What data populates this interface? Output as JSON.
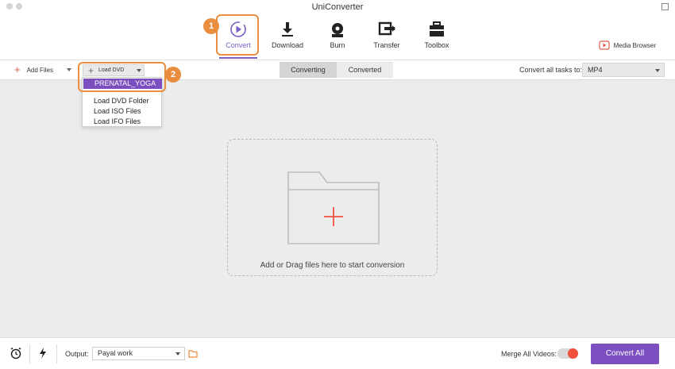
{
  "window": {
    "title": "UniConverter"
  },
  "toolbar": {
    "tabs": [
      {
        "label": "Convert",
        "icon": "convert-icon"
      },
      {
        "label": "Download",
        "icon": "download-icon"
      },
      {
        "label": "Burn",
        "icon": "burn-icon"
      },
      {
        "label": "Transfer",
        "icon": "transfer-icon"
      },
      {
        "label": "Toolbox",
        "icon": "toolbox-icon"
      }
    ],
    "media_browser": "Media Browser",
    "step_badges": [
      "1",
      "2"
    ]
  },
  "subbar": {
    "add_files": "Add Files",
    "load_dvd": "Load DVD",
    "segments": [
      "Converting",
      "Converted"
    ],
    "convert_all_label": "Convert all tasks to:",
    "format": "MP4"
  },
  "dropdown": {
    "items": [
      "PRENATAL_YOGA",
      "Load DVD Folder",
      "Load ISO Files",
      "Load IFO Files"
    ]
  },
  "dropzone": {
    "text": "Add or Drag files here to start conversion"
  },
  "footer": {
    "output_label": "Output:",
    "output_value": "Payal work",
    "merge_label": "Merge All Videos:",
    "convert_all_button": "Convert All"
  },
  "colors": {
    "accent": "#7b4fbf",
    "highlight": "#e98d3f",
    "plus": "#f0523e"
  }
}
